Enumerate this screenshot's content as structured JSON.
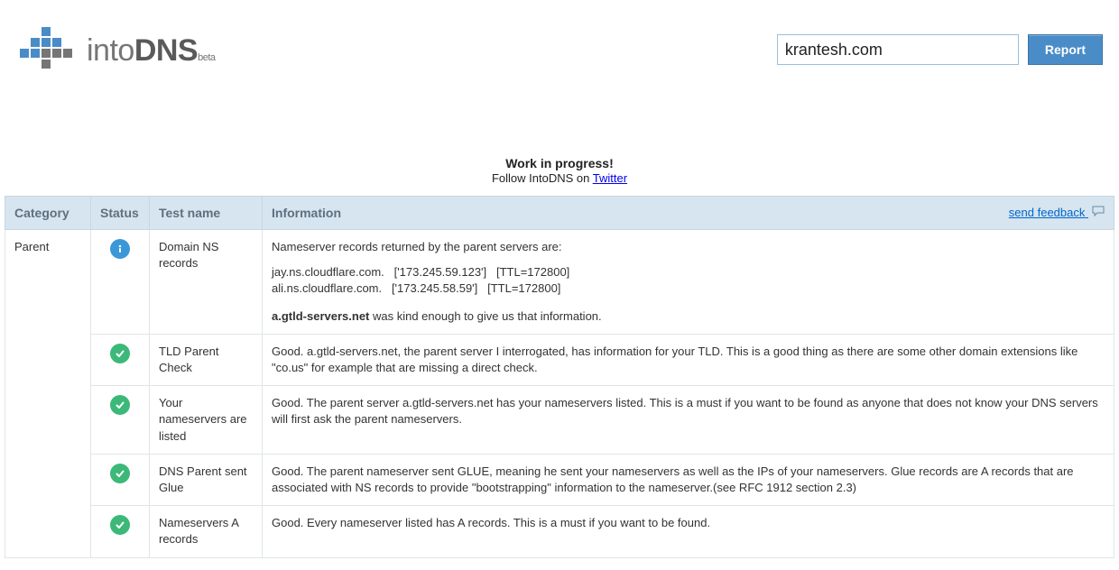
{
  "header": {
    "logo_prefix": "into",
    "logo_main": "DNS",
    "logo_suffix": "beta",
    "domain_input_value": "krantesh.com",
    "report_button_label": "Report"
  },
  "banner": {
    "title": "Work in progress!",
    "subtitle_prefix": "Follow IntoDNS on ",
    "subtitle_link": "Twitter"
  },
  "columns": {
    "category": "Category",
    "status": "Status",
    "test": "Test name",
    "info": "Information",
    "feedback_link": "send feedback"
  },
  "rows": [
    {
      "category": "Parent",
      "status": "info",
      "test": "Domain NS records",
      "info_ns": {
        "intro": "Nameserver records returned by the parent servers are:",
        "lines": "jay.ns.cloudflare.com.   ['173.245.59.123']   [TTL=172800]\nali.ns.cloudflare.com.   ['173.245.58.59']   [TTL=172800]",
        "source_bold": "a.gtld-servers.net",
        "source_rest": " was kind enough to give us that information."
      }
    },
    {
      "category": "",
      "status": "pass",
      "test": "TLD Parent Check",
      "info": "Good. a.gtld-servers.net, the parent server I interrogated, has information for your TLD. This is a good thing as there are some other domain extensions like \"co.us\" for example that are missing a direct check."
    },
    {
      "category": "",
      "status": "pass",
      "test": "Your nameservers are listed",
      "info": "Good. The parent server a.gtld-servers.net has your nameservers listed. This is a must if you want to be found as anyone that does not know your DNS servers will first ask the parent nameservers."
    },
    {
      "category": "",
      "status": "pass",
      "test": "DNS Parent sent Glue",
      "info": "Good. The parent nameserver sent GLUE, meaning he sent your nameservers as well as the IPs of your nameservers. Glue records are A records that are associated with NS records to provide \"bootstrapping\" information to the nameserver.(see RFC 1912 section 2.3)"
    },
    {
      "category": "",
      "status": "pass",
      "test": "Nameservers A records",
      "info": "Good. Every nameserver listed has A records. This is a must if you want to be found."
    }
  ]
}
